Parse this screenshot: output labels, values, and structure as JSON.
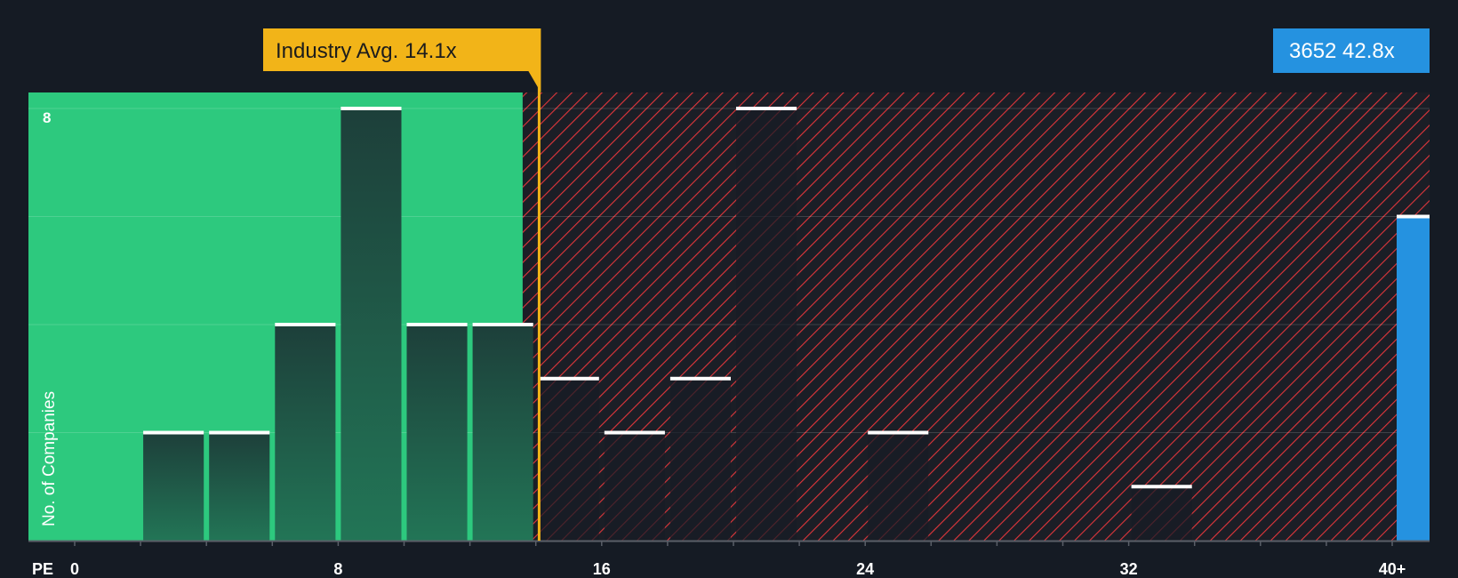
{
  "colors": {
    "background": "#151b24",
    "fair_zone": "#2dc97e",
    "overvalued_stripe": "#e0363b",
    "bar_fill_top": "#1d3f3a",
    "bar_fill_bottom": "#227556",
    "bar_cap": "#ffffff",
    "industry_marker": "#f2b418",
    "company_bar": "#2592e0",
    "text": "#ffffff",
    "tick_text": "#ffffff"
  },
  "industry_label": "Industry Avg. 14.1x",
  "company_label": "3652 42.8x",
  "chart_data": {
    "type": "bar",
    "x_axis_label": "PE",
    "y_axis_label": "No. of Companies",
    "xlim": [
      0,
      41.5
    ],
    "ylim": [
      0,
      8.3
    ],
    "x_ticks": [
      {
        "value": 0,
        "label": "0"
      },
      {
        "value": 8,
        "label": "8"
      },
      {
        "value": 16,
        "label": "16"
      },
      {
        "value": 24,
        "label": "24"
      },
      {
        "value": 32,
        "label": "32"
      },
      {
        "value": 40,
        "label": "40+"
      }
    ],
    "y_ticks": [
      {
        "value": 8,
        "label": "8"
      }
    ],
    "gridlines_y": [
      2,
      4,
      6,
      8
    ],
    "bin_width": 2,
    "bins": [
      {
        "x0": 2,
        "x1": 4,
        "count": 2
      },
      {
        "x0": 4,
        "x1": 6,
        "count": 2
      },
      {
        "x0": 6,
        "x1": 8,
        "count": 4
      },
      {
        "x0": 8,
        "x1": 10,
        "count": 8
      },
      {
        "x0": 10,
        "x1": 12,
        "count": 4
      },
      {
        "x0": 12,
        "x1": 14,
        "count": 4
      },
      {
        "x0": 14,
        "x1": 16,
        "count": 3
      },
      {
        "x0": 16,
        "x1": 18,
        "count": 2
      },
      {
        "x0": 18,
        "x1": 20,
        "count": 3
      },
      {
        "x0": 20,
        "x1": 22,
        "count": 8
      },
      {
        "x0": 24,
        "x1": 26,
        "count": 2
      },
      {
        "x0": 32,
        "x1": 34,
        "count": 1
      }
    ],
    "industry_average": 14.1,
    "fair_zone_end": 13.6,
    "company": {
      "name": "3652",
      "pe": 42.8,
      "count": 6
    }
  }
}
